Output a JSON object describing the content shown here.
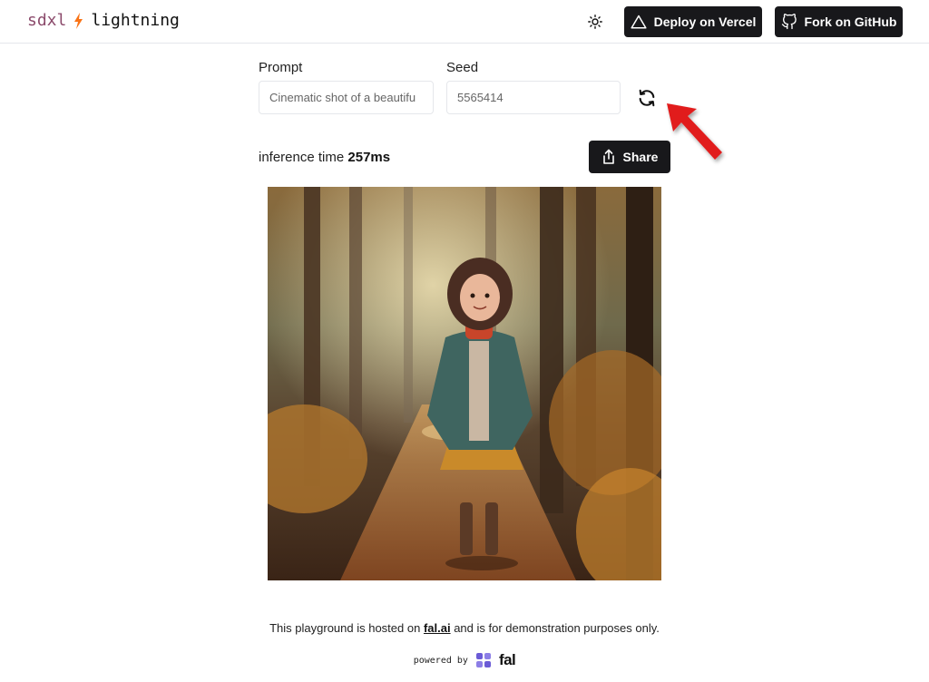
{
  "header": {
    "logo_left": "sdxl",
    "logo_right": "lightning",
    "theme_icon": "sun-icon",
    "deploy_label": "Deploy on Vercel",
    "fork_label": "Fork on GitHub"
  },
  "form": {
    "prompt_label": "Prompt",
    "prompt_value": "Cinematic shot of a beautifu",
    "seed_label": "Seed",
    "seed_value": "5565414",
    "refresh_icon": "refresh-icon"
  },
  "result": {
    "inference_label": "inference time",
    "inference_value": "257ms",
    "share_label": "Share"
  },
  "footer": {
    "text_before": "This playground is hosted on",
    "link_text": "fal.ai",
    "text_after": "and is for demonstration purposes only.",
    "powered_by": "powered by",
    "brand": "fal"
  },
  "colors": {
    "button_bg": "#18181b",
    "logo_accent": "#f97316",
    "annotation_arrow": "#e11d1d"
  }
}
